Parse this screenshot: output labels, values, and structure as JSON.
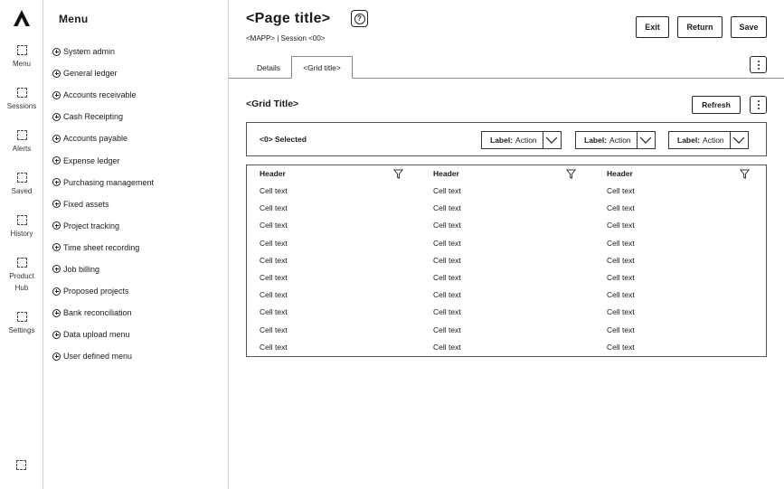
{
  "rail": {
    "items": [
      {
        "label": "Menu"
      },
      {
        "label": "Sessions"
      },
      {
        "label": "Alerts"
      },
      {
        "label": "Saved"
      },
      {
        "label": "History"
      },
      {
        "label": "Product Hub"
      },
      {
        "label": "Settings"
      }
    ]
  },
  "menu": {
    "title": "Menu",
    "items": [
      "System admin",
      "General ledger",
      "Accounts receivable",
      "Cash Receipting",
      "Accounts payable",
      "Expense ledger",
      "Purchasing management",
      "Fixed assets",
      "Project tracking",
      "Time sheet recording",
      "Job billing",
      "Proposed projects",
      "Bank reconciliation",
      "Data upload menu",
      "User defined menu"
    ]
  },
  "header": {
    "title": "<Page title>",
    "help_symbol": "?",
    "subtitle": "<MAPP> | Session <00>",
    "buttons": {
      "exit": "Exit",
      "return": "Return",
      "save": "Save"
    }
  },
  "tabs": [
    "Details",
    "<Grid title>"
  ],
  "grid": {
    "title": "<Grid Title>",
    "refresh_label": "Refresh",
    "selected_text": "<0> Selected",
    "actions": [
      {
        "label": "Label:",
        "value": "Action"
      },
      {
        "label": "Label:",
        "value": "Action"
      },
      {
        "label": "Label:",
        "value": "Action"
      }
    ],
    "headers": [
      "Header",
      "Header",
      "Header"
    ],
    "rows": [
      [
        "Cell text",
        "Cell text",
        "Cell text"
      ],
      [
        "Cell text",
        "Cell text",
        "Cell text"
      ],
      [
        "Cell text",
        "Cell text",
        "Cell text"
      ],
      [
        "Cell text",
        "Cell text",
        "Cell text"
      ],
      [
        "Cell text",
        "Cell text",
        "Cell text"
      ],
      [
        "Cell text",
        "Cell text",
        "Cell text"
      ],
      [
        "Cell text",
        "Cell text",
        "Cell text"
      ],
      [
        "Cell text",
        "Cell text",
        "Cell text"
      ],
      [
        "Cell text",
        "Cell text",
        "Cell text"
      ],
      [
        "Cell text",
        "Cell text",
        "Cell text"
      ]
    ]
  }
}
